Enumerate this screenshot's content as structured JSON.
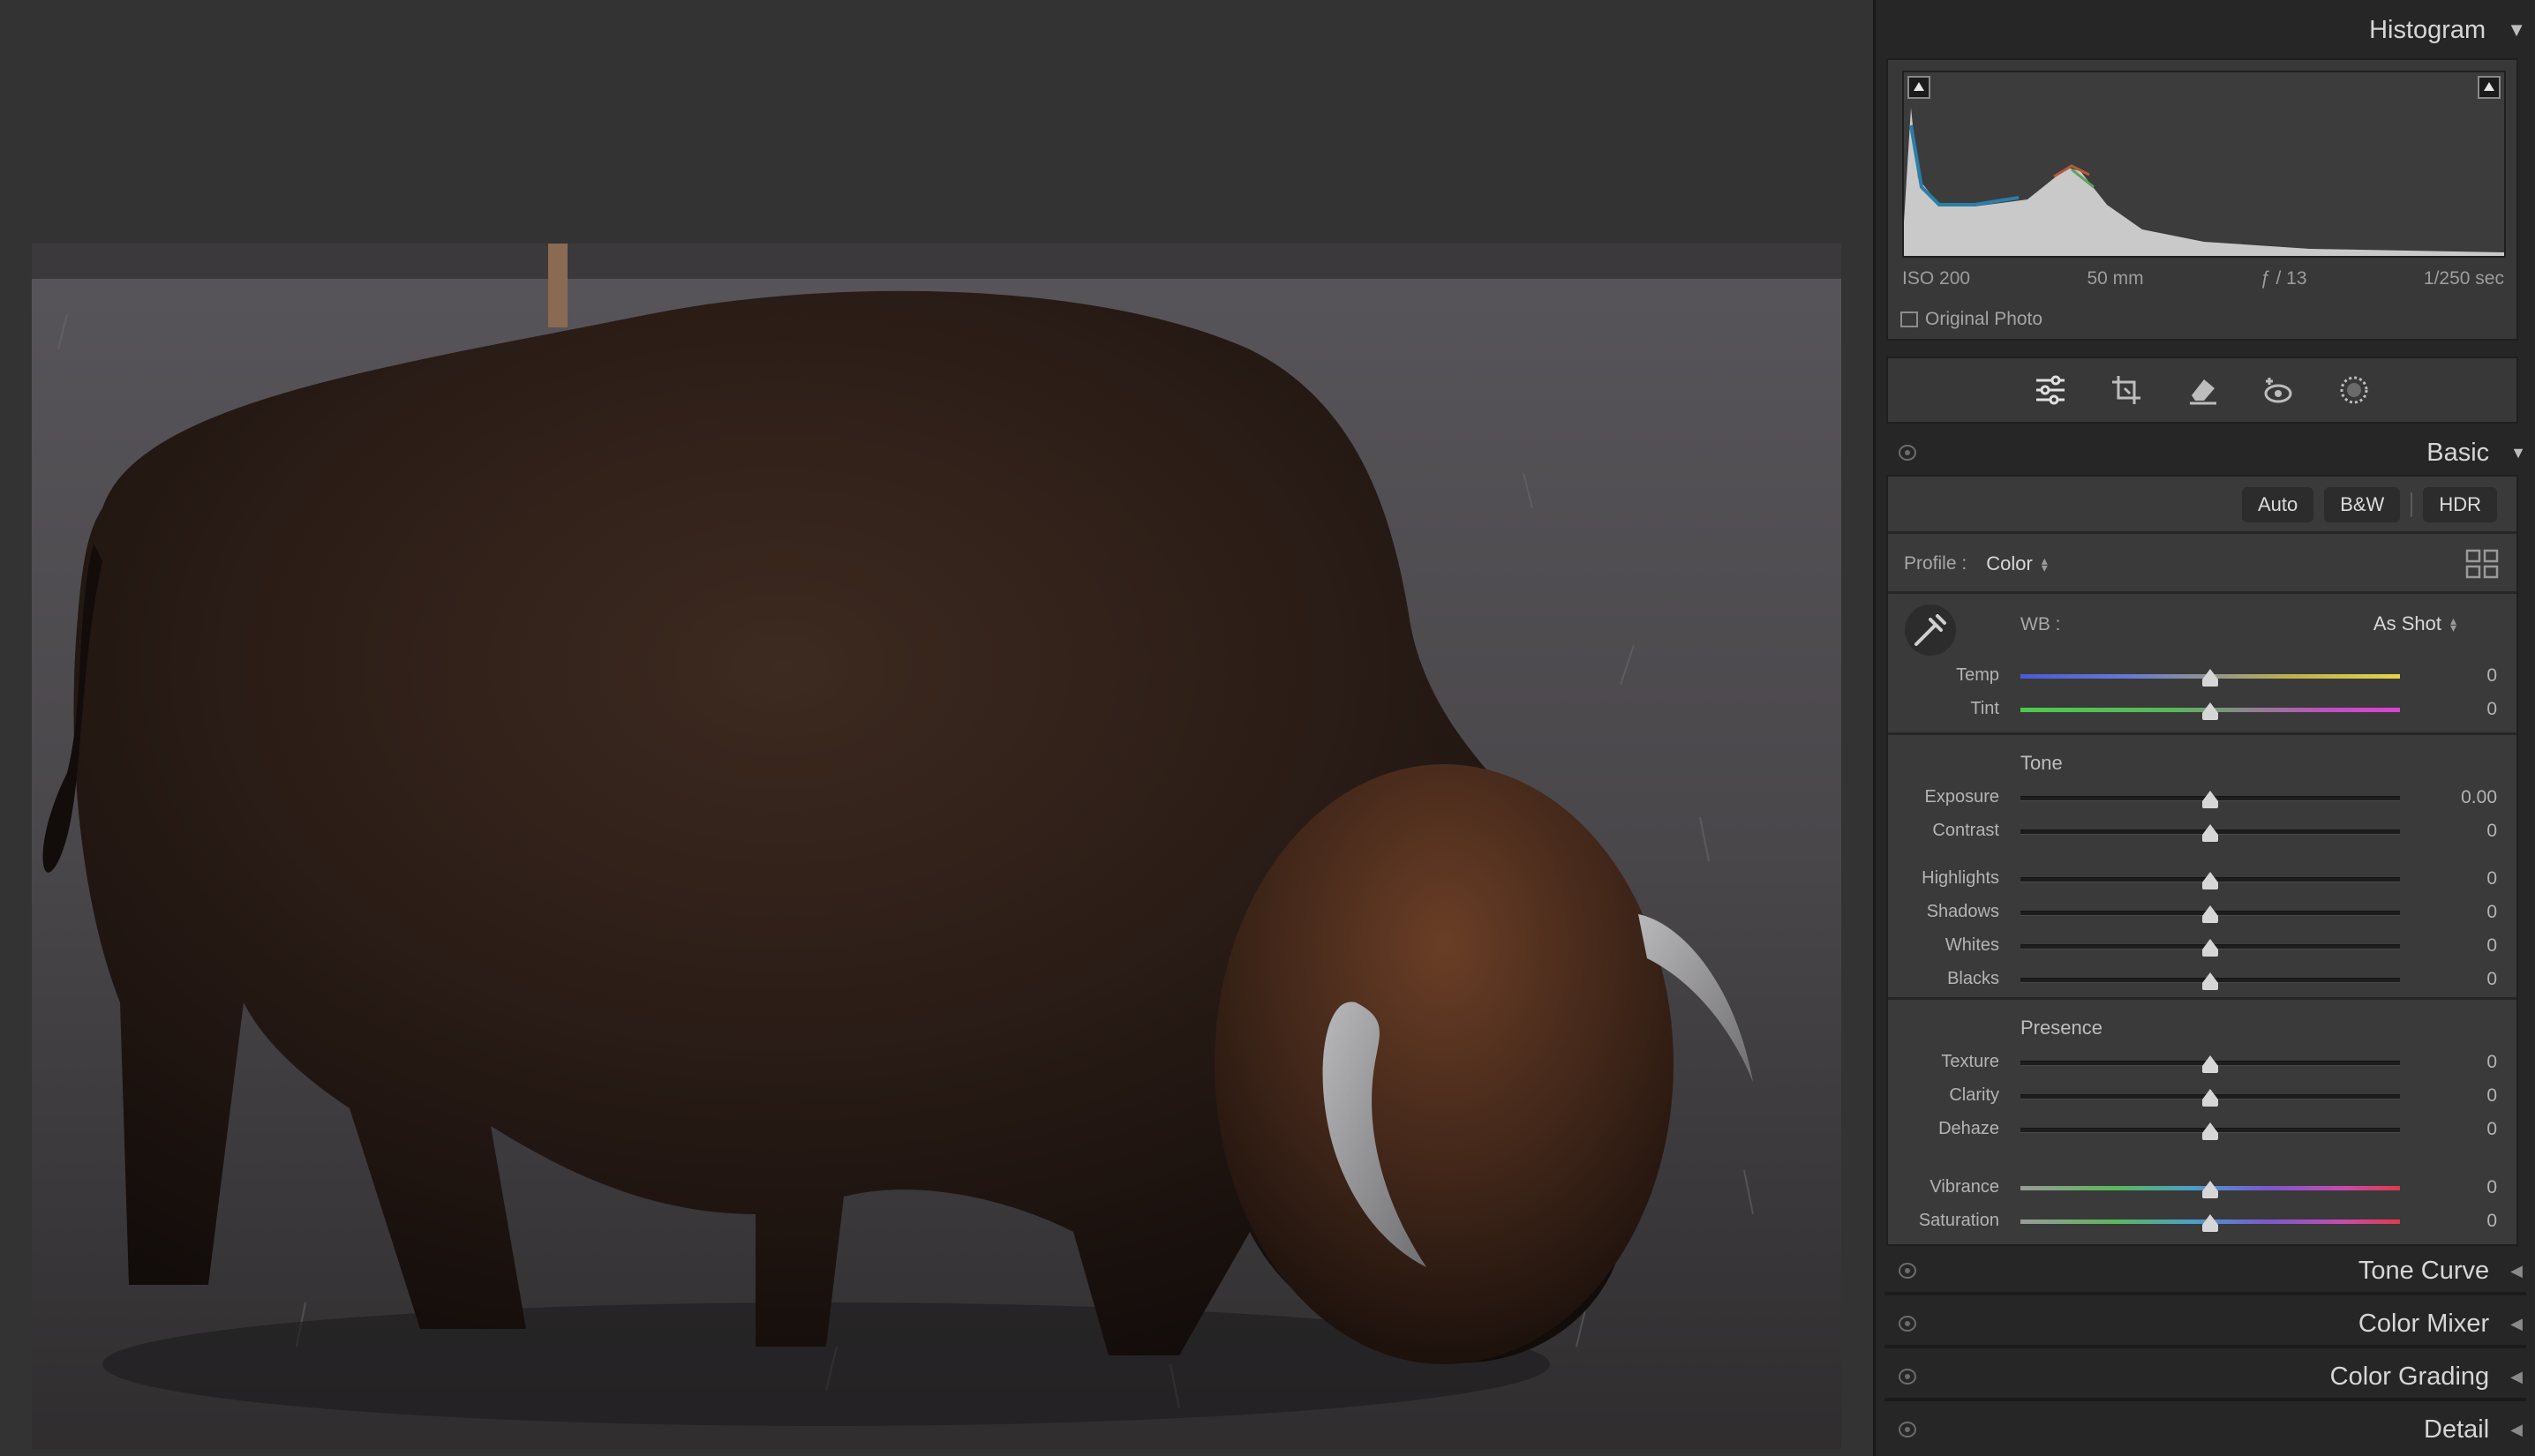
{
  "panel": {
    "histogram": {
      "title": "Histogram",
      "iso": "ISO 200",
      "focal": "50 mm",
      "aperture": "ƒ / 13",
      "shutter": "1/250 sec",
      "original_photo": "Original Photo"
    },
    "basic": {
      "title": "Basic",
      "auto": "Auto",
      "bw": "B&W",
      "hdr": "HDR",
      "profile_label": "Profile :",
      "profile_value": "Color",
      "wb_label": "WB :",
      "wb_value": "As Shot",
      "tone_title": "Tone",
      "presence_title": "Presence",
      "sliders": {
        "temp": {
          "label": "Temp",
          "value": "0"
        },
        "tint": {
          "label": "Tint",
          "value": "0"
        },
        "exposure": {
          "label": "Exposure",
          "value": "0.00"
        },
        "contrast": {
          "label": "Contrast",
          "value": "0"
        },
        "highlights": {
          "label": "Highlights",
          "value": "0"
        },
        "shadows": {
          "label": "Shadows",
          "value": "0"
        },
        "whites": {
          "label": "Whites",
          "value": "0"
        },
        "blacks": {
          "label": "Blacks",
          "value": "0"
        },
        "texture": {
          "label": "Texture",
          "value": "0"
        },
        "clarity": {
          "label": "Clarity",
          "value": "0"
        },
        "dehaze": {
          "label": "Dehaze",
          "value": "0"
        },
        "vibrance": {
          "label": "Vibrance",
          "value": "0"
        },
        "saturation": {
          "label": "Saturation",
          "value": "0"
        }
      }
    },
    "sections": {
      "tone_curve": "Tone Curve",
      "color_mixer": "Color Mixer",
      "color_grading": "Color Grading",
      "detail": "Detail"
    }
  },
  "colors": {
    "panel_bg": "#262626",
    "section_bg": "#3a3a3a",
    "text": "#c8c8c8"
  }
}
